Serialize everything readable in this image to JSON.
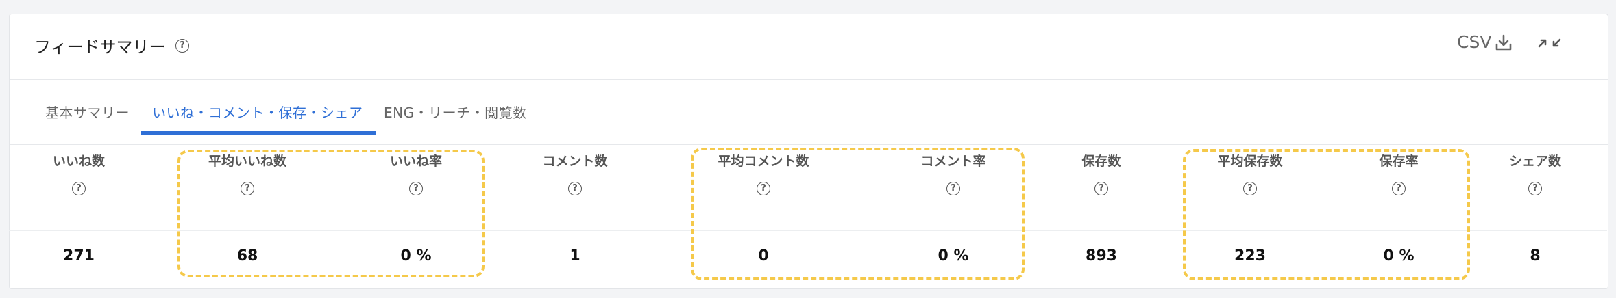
{
  "header": {
    "title": "フィードサマリー",
    "csv_label": "CSV",
    "help_glyph": "?"
  },
  "tabs": [
    {
      "label": "基本サマリー",
      "active": false
    },
    {
      "label": "いいね・コメント・保存・シェア",
      "active": true
    },
    {
      "label": "ENG・リーチ・閲覧数",
      "active": false
    }
  ],
  "columns": [
    {
      "label": "いいね数",
      "value": "271"
    },
    {
      "label": "平均いいね数",
      "value": "68"
    },
    {
      "label": "いいね率",
      "value": "0 %"
    },
    {
      "label": "コメント数",
      "value": "1"
    },
    {
      "label": "平均コメント数",
      "value": "0"
    },
    {
      "label": "コメント率",
      "value": "0 %"
    },
    {
      "label": "保存数",
      "value": "893"
    },
    {
      "label": "平均保存数",
      "value": "223"
    },
    {
      "label": "保存率",
      "value": "0 %"
    },
    {
      "label": "シェア数",
      "value": "8"
    }
  ],
  "colors": {
    "accent": "#2f6fd6",
    "highlight": "#f5c94a"
  },
  "icons": [
    "help-icon",
    "download-icon",
    "collapse-icon"
  ]
}
